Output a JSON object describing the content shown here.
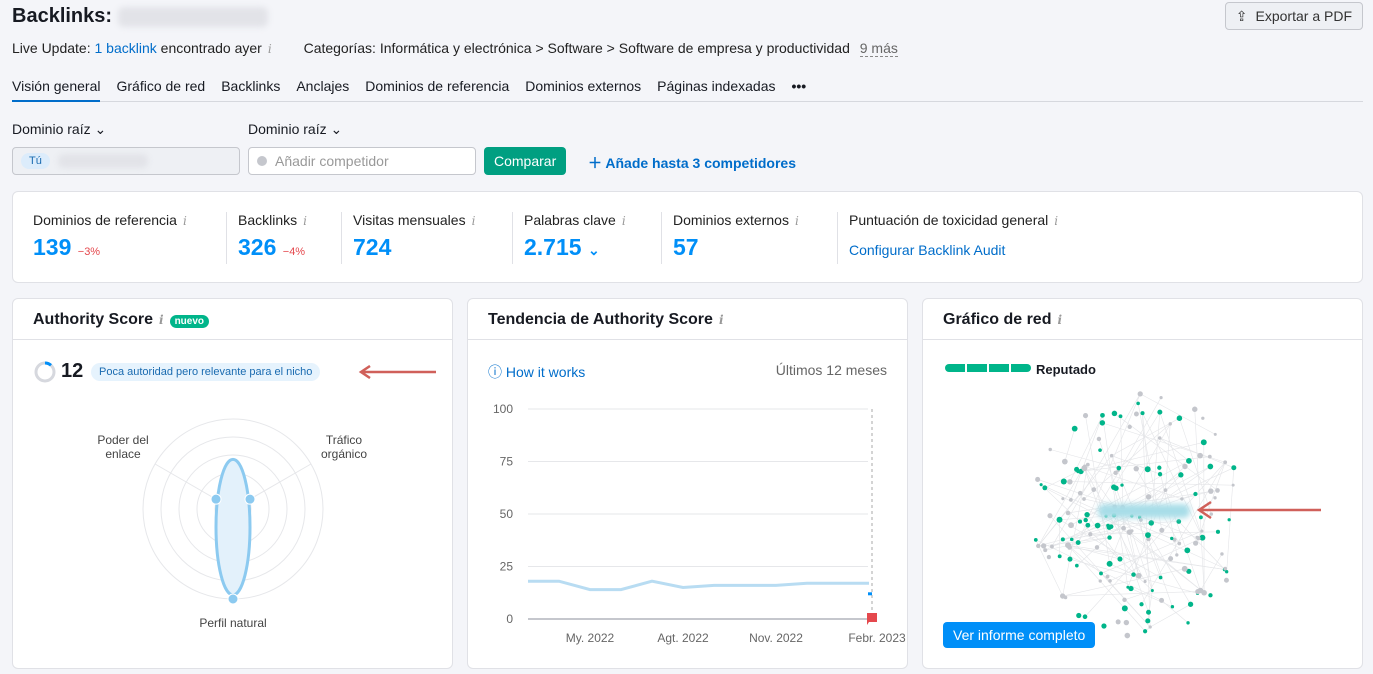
{
  "header": {
    "title": "Backlinks:",
    "export_label": "Exportar a PDF",
    "live_prefix": "Live Update:",
    "live_link": "1 backlink",
    "live_suffix": "encontrado ayer",
    "categories": "Categorías: Informática y electrónica > Software > Software de empresa y productividad",
    "more": "9 más"
  },
  "tabs": [
    {
      "label": "Visión general",
      "active": true
    },
    {
      "label": "Gráfico de red"
    },
    {
      "label": "Backlinks"
    },
    {
      "label": "Anclajes"
    },
    {
      "label": "Dominios de referencia"
    },
    {
      "label": "Dominios externos"
    },
    {
      "label": "Páginas indexadas"
    },
    {
      "label": "•••"
    }
  ],
  "filters": {
    "dropdown1": "Dominio raíz",
    "dropdown2": "Dominio raíz",
    "you_badge": "Tú",
    "competitor_placeholder": "Añadir competidor",
    "compare": "Comparar",
    "add_competitors": "Añade hasta 3 competidores"
  },
  "metrics": [
    {
      "label": "Dominios de referencia",
      "value": "139",
      "delta": "−3%"
    },
    {
      "label": "Backlinks",
      "value": "326",
      "delta": "−4%"
    },
    {
      "label": "Visitas mensuales",
      "value": "724"
    },
    {
      "label": "Palabras clave",
      "value": "2.715"
    },
    {
      "label": "Dominios externos",
      "value": "57"
    },
    {
      "label": "Puntuación de toxicidad general",
      "link": "Configurar Backlink Audit"
    }
  ],
  "authority": {
    "title": "Authority Score",
    "badge": "nuevo",
    "score": "12",
    "note": "Poca autoridad pero relevante para el nicho",
    "axes": [
      {
        "label": "Poder del enlace",
        "value": 0.1
      },
      {
        "label": "Tráfico orgánico",
        "value": 0.1
      },
      {
        "label": "Perfil natural",
        "value": 0.85
      }
    ]
  },
  "trend": {
    "title": "Tendencia de Authority Score",
    "how": "How it works",
    "period": "Últimos 12 meses"
  },
  "chart_data": {
    "type": "line",
    "ylim": [
      0,
      100
    ],
    "yticks": [
      "100",
      "75",
      "50",
      "25",
      "0"
    ],
    "xticks": [
      "My. 2022",
      "Agt. 2022",
      "Nov. 2022",
      "Febr. 2023"
    ],
    "x": [
      "Mar 2022",
      "Abr 2022",
      "My. 2022",
      "Jun 2022",
      "Jul 2022",
      "Agt. 2022",
      "Sept 2022",
      "Oct 2022",
      "Nov. 2022",
      "Dic 2022",
      "Ene 2023",
      "Febr. 2023"
    ],
    "values": [
      18,
      18,
      14,
      14,
      18,
      15,
      16,
      16,
      16,
      17,
      17,
      17
    ],
    "current": 12,
    "accent": "#008ff8",
    "history_color": "#b8dcf2"
  },
  "network": {
    "title": "Gráfico de red",
    "status": "Reputado",
    "button": "Ver informe completo",
    "green": "#00b58a",
    "gray": "#c4c6cc"
  }
}
